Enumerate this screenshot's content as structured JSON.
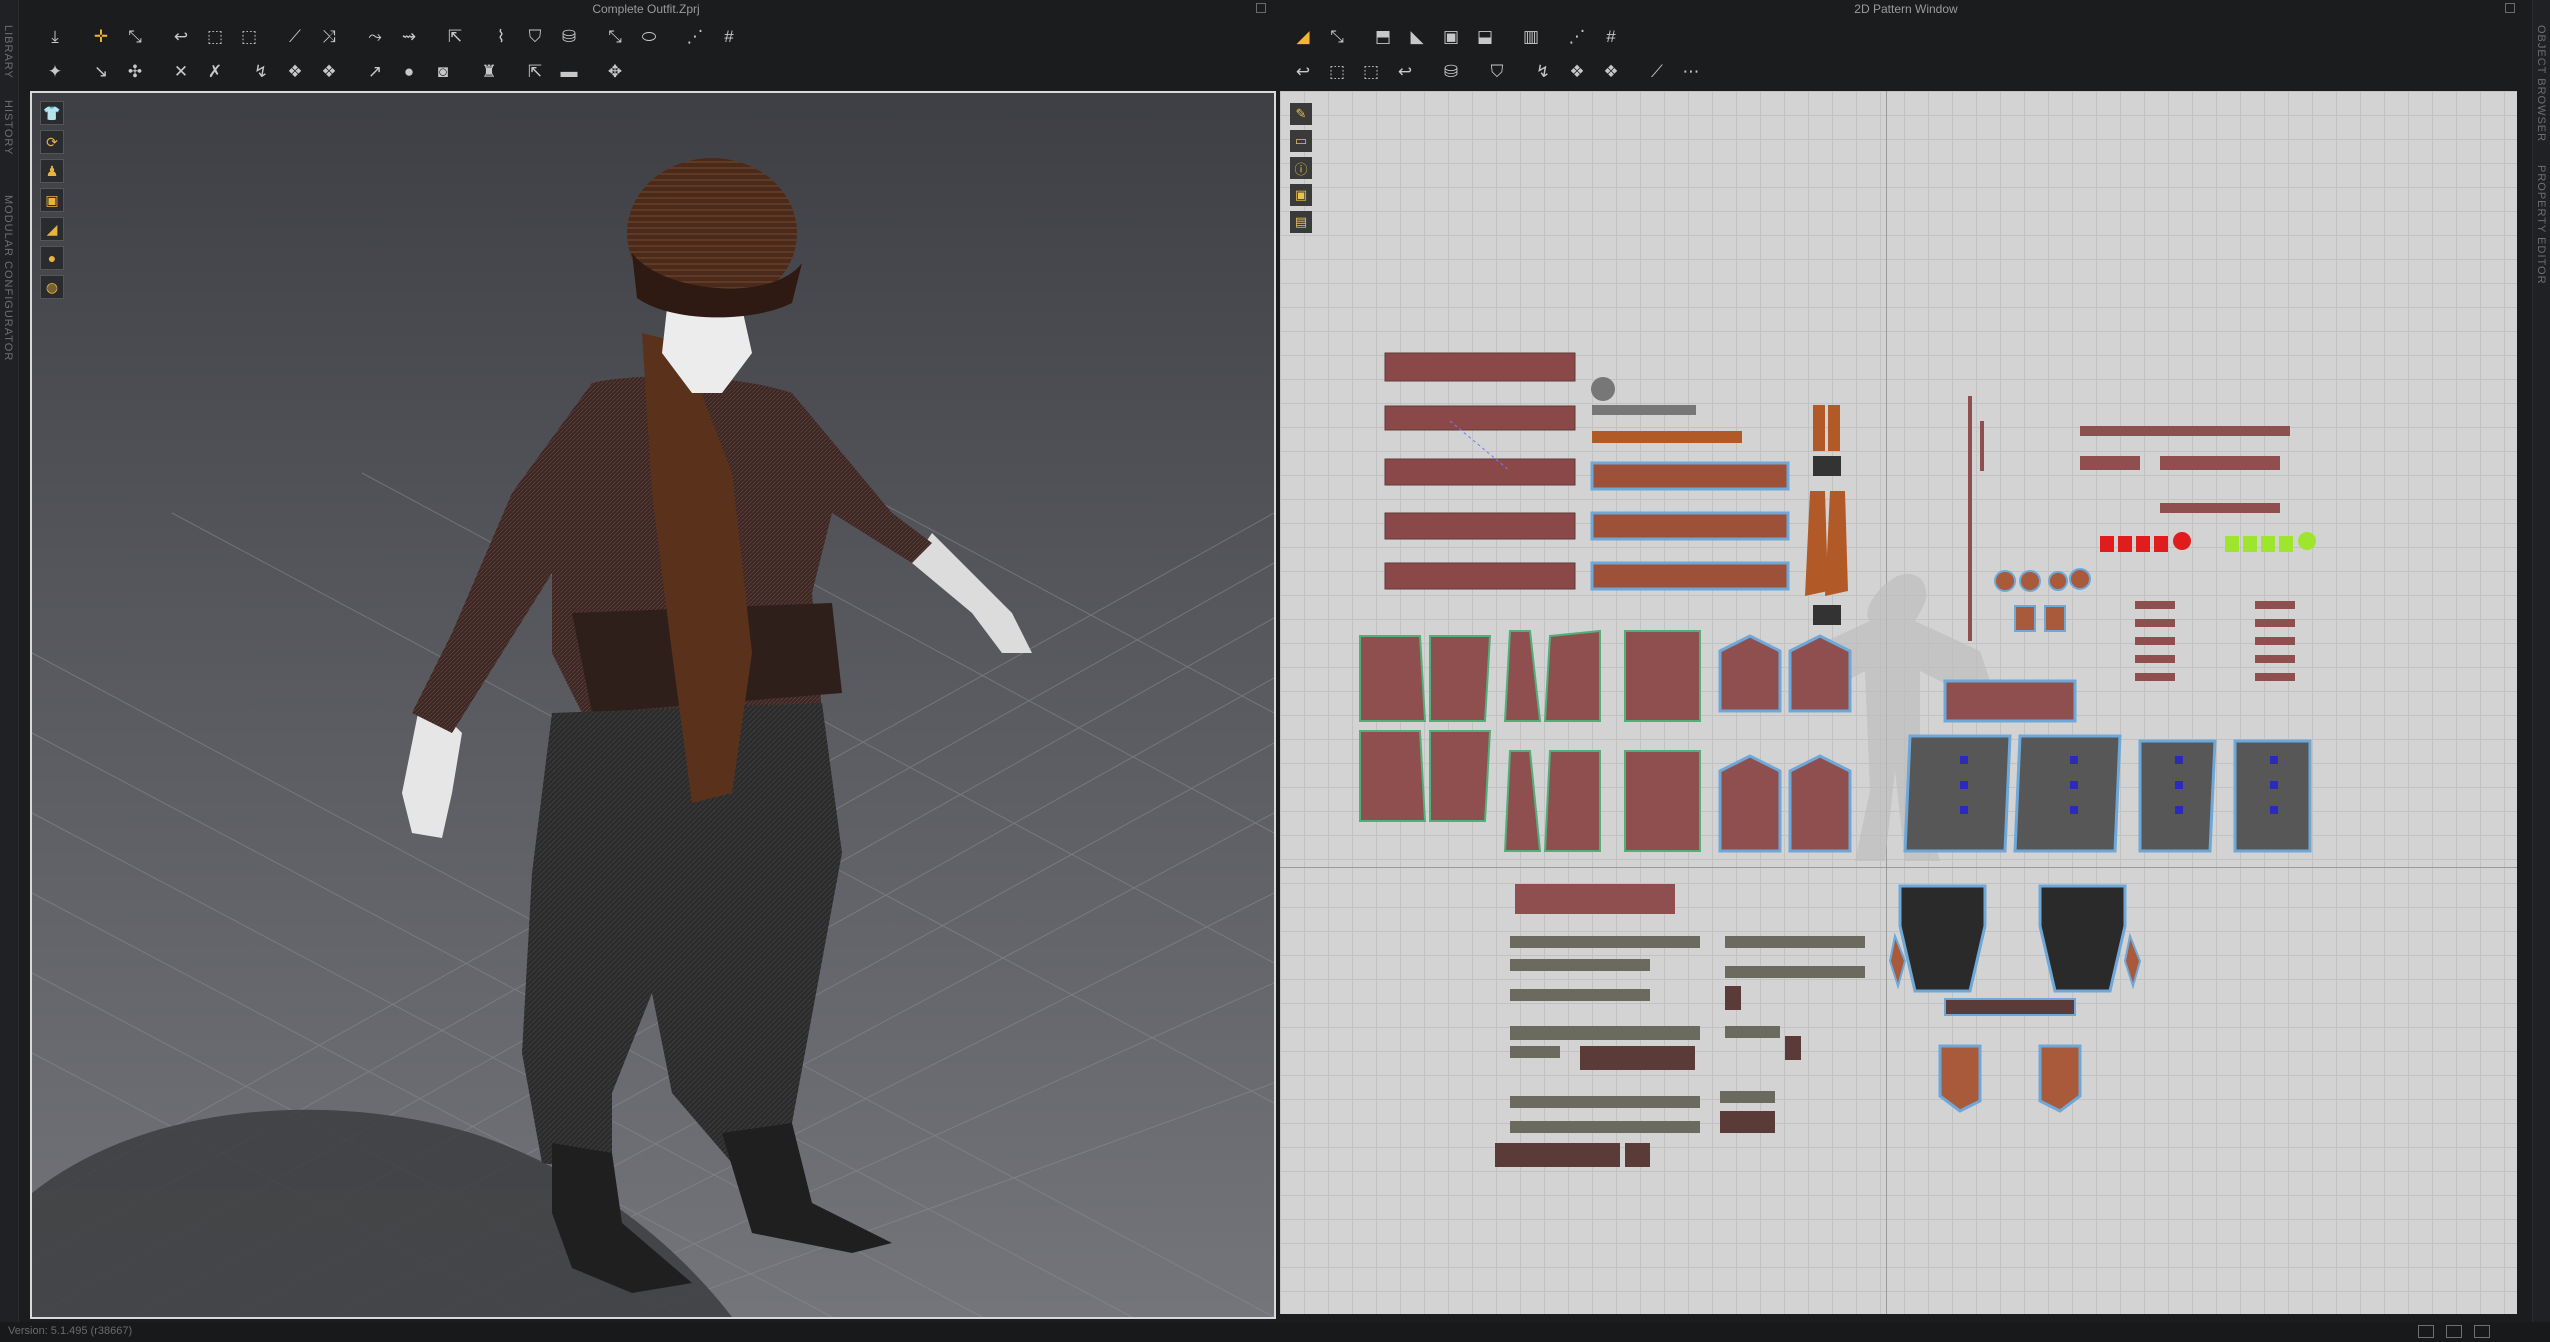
{
  "left_panel_tabs": [
    "LIBRARY",
    "HISTORY",
    "MODULAR CONFIGURATOR"
  ],
  "right_panel_tabs": [
    "OBJECT BROWSER",
    "PROPERTY EDITOR"
  ],
  "window_3d": {
    "title": "Complete Outfit.Zprj",
    "toolbar_row1_icons": [
      "simulate-icon",
      "select-move-icon",
      "select-mesh-icon",
      "edit-pattern-icon",
      "transform-icon",
      "edit-point-icon",
      "polygon-icon",
      "rectangle-icon",
      "internal-line-icon",
      "fold-icon",
      "tack-icon",
      "pin-icon",
      "button-icon",
      "buttonhole-icon",
      "zipper-icon",
      "arrange-icon",
      "strap-icon",
      "fit-icon",
      "measure-icon",
      "grid-icon"
    ],
    "toolbar_row2_icons": [
      "avatar-pose-icon",
      "tape-icon",
      "trim-icon",
      "hair-icon",
      "shoes-icon",
      "symmetry-icon",
      "texture-icon",
      "sew-icon",
      "free-sew-icon",
      "sphere-icon",
      "graphic-icon",
      "sculpt-icon",
      "layer-icon",
      "fold-arrange-icon",
      "move-icon"
    ],
    "side_tools": [
      "shirt-icon",
      "rotate-icon",
      "avatar-icon",
      "texture-icon",
      "flatten-icon",
      "person-icon",
      "globe-icon"
    ]
  },
  "window_2d": {
    "title": "2D Pattern Window",
    "toolbar_row1_icons": [
      "transform-pattern-icon",
      "edit-pattern-icon",
      "edit-curvature-icon",
      "add-point-icon",
      "rectangle-icon",
      "polygon-icon",
      "internal-line-icon",
      "segment-icon",
      "dart-icon",
      "trace-icon"
    ],
    "toolbar_row2_icons": [
      "notch-icon",
      "seam-allowance-icon",
      "sew-icon",
      "free-sew-icon",
      "fold-icon",
      "tack-icon",
      "pin-icon",
      "graphic-icon",
      "button-icon",
      "texture-icon",
      "measure-icon",
      "ruler-icon"
    ],
    "side_tools": [
      "pencil-icon",
      "select-icon",
      "info-icon",
      "texture-icon",
      "layer-icon"
    ]
  },
  "status": {
    "version": "Version: 5.1.495 (r38667)"
  },
  "colors": {
    "accent": "#f3b632",
    "pattern_fill": "#8f4f4e",
    "pattern_outline": "#6ea8d8",
    "trim_red": "#e01c1c",
    "trim_green": "#9ee62e"
  }
}
